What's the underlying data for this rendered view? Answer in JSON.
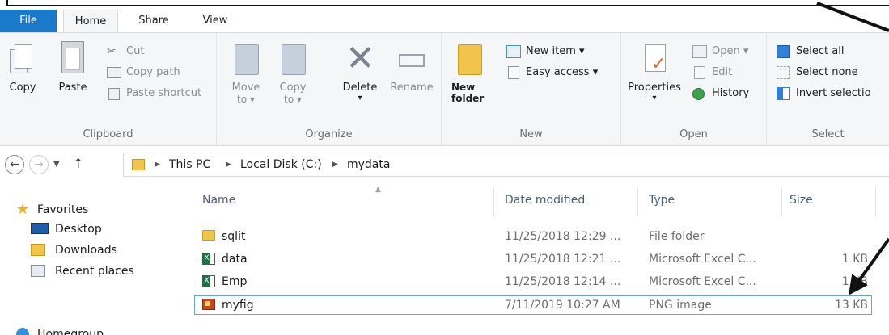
{
  "tabs": {
    "file": "File",
    "home": "Home",
    "share": "Share",
    "view": "View"
  },
  "ribbon": {
    "clipboard": {
      "label": "Clipboard",
      "copy": "Copy",
      "paste": "Paste",
      "cut": "Cut",
      "copy_path": "Copy path",
      "paste_shortcut": "Paste shortcut"
    },
    "organize": {
      "label": "Organize",
      "move_to": "Move\nto",
      "move_to_1": "Move",
      "move_to_2": "to ▾",
      "copy_to_1": "Copy",
      "copy_to_2": "to ▾",
      "delete": "Delete",
      "delete_caret": "▾",
      "rename": "Rename"
    },
    "new": {
      "label": "New",
      "new_folder_1": "New",
      "new_folder_2": "folder",
      "new_item": "New item ▾",
      "easy_access": "Easy access ▾"
    },
    "open": {
      "label": "Open",
      "properties": "Properties",
      "properties_caret": "▾",
      "open": "Open ▾",
      "edit": "Edit",
      "history": "History"
    },
    "select": {
      "label": "Select",
      "select_all": "Select all",
      "select_none": "Select none",
      "invert": "Invert selectio"
    }
  },
  "nav": {
    "back": "←",
    "forward": "→",
    "dropdown": "▼",
    "up": "↑",
    "breadcrumb": [
      "This PC",
      "Local Disk (C:)",
      "mydata"
    ]
  },
  "left_pane": {
    "favorites": "Favorites",
    "items": [
      "Desktop",
      "Downloads",
      "Recent places"
    ],
    "homegroup": "Homegroup"
  },
  "file_list": {
    "columns": {
      "name": "Name",
      "date": "Date modified",
      "type": "Type",
      "size": "Size"
    },
    "rows": [
      {
        "name": "sqlit",
        "date": "11/25/2018 12:29 ...",
        "type": "File folder",
        "size": "",
        "icon": "folder-icon"
      },
      {
        "name": "data",
        "date": "11/25/2018 12:21 ...",
        "type": "Microsoft Excel C...",
        "size": "1 KB",
        "icon": "excel-csv-icon"
      },
      {
        "name": "Emp",
        "date": "11/25/2018 12:14 ...",
        "type": "Microsoft Excel C...",
        "size": "1 KB",
        "icon": "excel-csv-icon"
      },
      {
        "name": "myfig",
        "date": "7/11/2019 10:27 AM",
        "type": "PNG image",
        "size": "13 KB",
        "icon": "png-image-icon"
      }
    ]
  },
  "colors": {
    "file_tab": "#1979ca",
    "ribbon_bg": "#f5f6f7",
    "selection_border": "#66a3e0",
    "folder": "#f1c54c"
  }
}
